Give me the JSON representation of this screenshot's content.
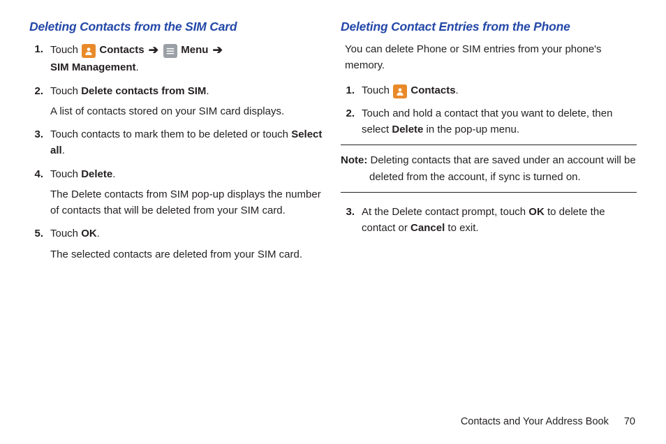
{
  "left": {
    "heading": "Deleting Contacts from the SIM Card",
    "steps": [
      {
        "n": "1.",
        "pre": "Touch ",
        "iconA": "contacts",
        "afterA": " Contacts ",
        "arrow1": "➔",
        "iconB": "menu",
        "afterB": " Menu ",
        "arrow2": "➔",
        "line2_bold": "SIM Management",
        "line2_after": "."
      },
      {
        "n": "2.",
        "pre": "Touch ",
        "bold": "Delete contacts from SIM",
        "post": ".",
        "sub": "A list of contacts stored on your SIM card displays."
      },
      {
        "n": "3.",
        "text": "Touch contacts to mark them to be deleted or touch ",
        "bold_end": "Select all",
        "post": "."
      },
      {
        "n": "4.",
        "pre": "Touch ",
        "bold": "Delete",
        "post": ".",
        "sub": "The Delete contacts from SIM pop-up displays the number of contacts that will be deleted from your SIM card."
      },
      {
        "n": "5.",
        "pre": "Touch ",
        "bold": "OK",
        "post": ".",
        "sub": "The selected contacts are deleted from your SIM card."
      }
    ]
  },
  "right": {
    "heading": "Deleting Contact Entries from the Phone",
    "intro": "You can delete Phone or SIM entries from your phone's memory.",
    "steps": [
      {
        "n": "1.",
        "pre": "Touch ",
        "iconA": "contacts",
        "afterA": " Contacts",
        "post": "."
      },
      {
        "n": "2.",
        "text": "Touch and hold a contact that you want to delete, then select ",
        "bold_end": "Delete",
        "post": " in the pop-up menu."
      }
    ],
    "note": {
      "label": "Note:",
      "body": " Deleting contacts that are saved under an account will be deleted from the account, if sync is turned on."
    },
    "step3": {
      "n": "3.",
      "t1": "At the Delete contact prompt, touch ",
      "b1": "OK",
      "t2": " to delete the contact or ",
      "b2": "Cancel",
      "t3": " to exit."
    }
  },
  "footer": {
    "section": "Contacts and Your Address Book",
    "page": "70"
  }
}
